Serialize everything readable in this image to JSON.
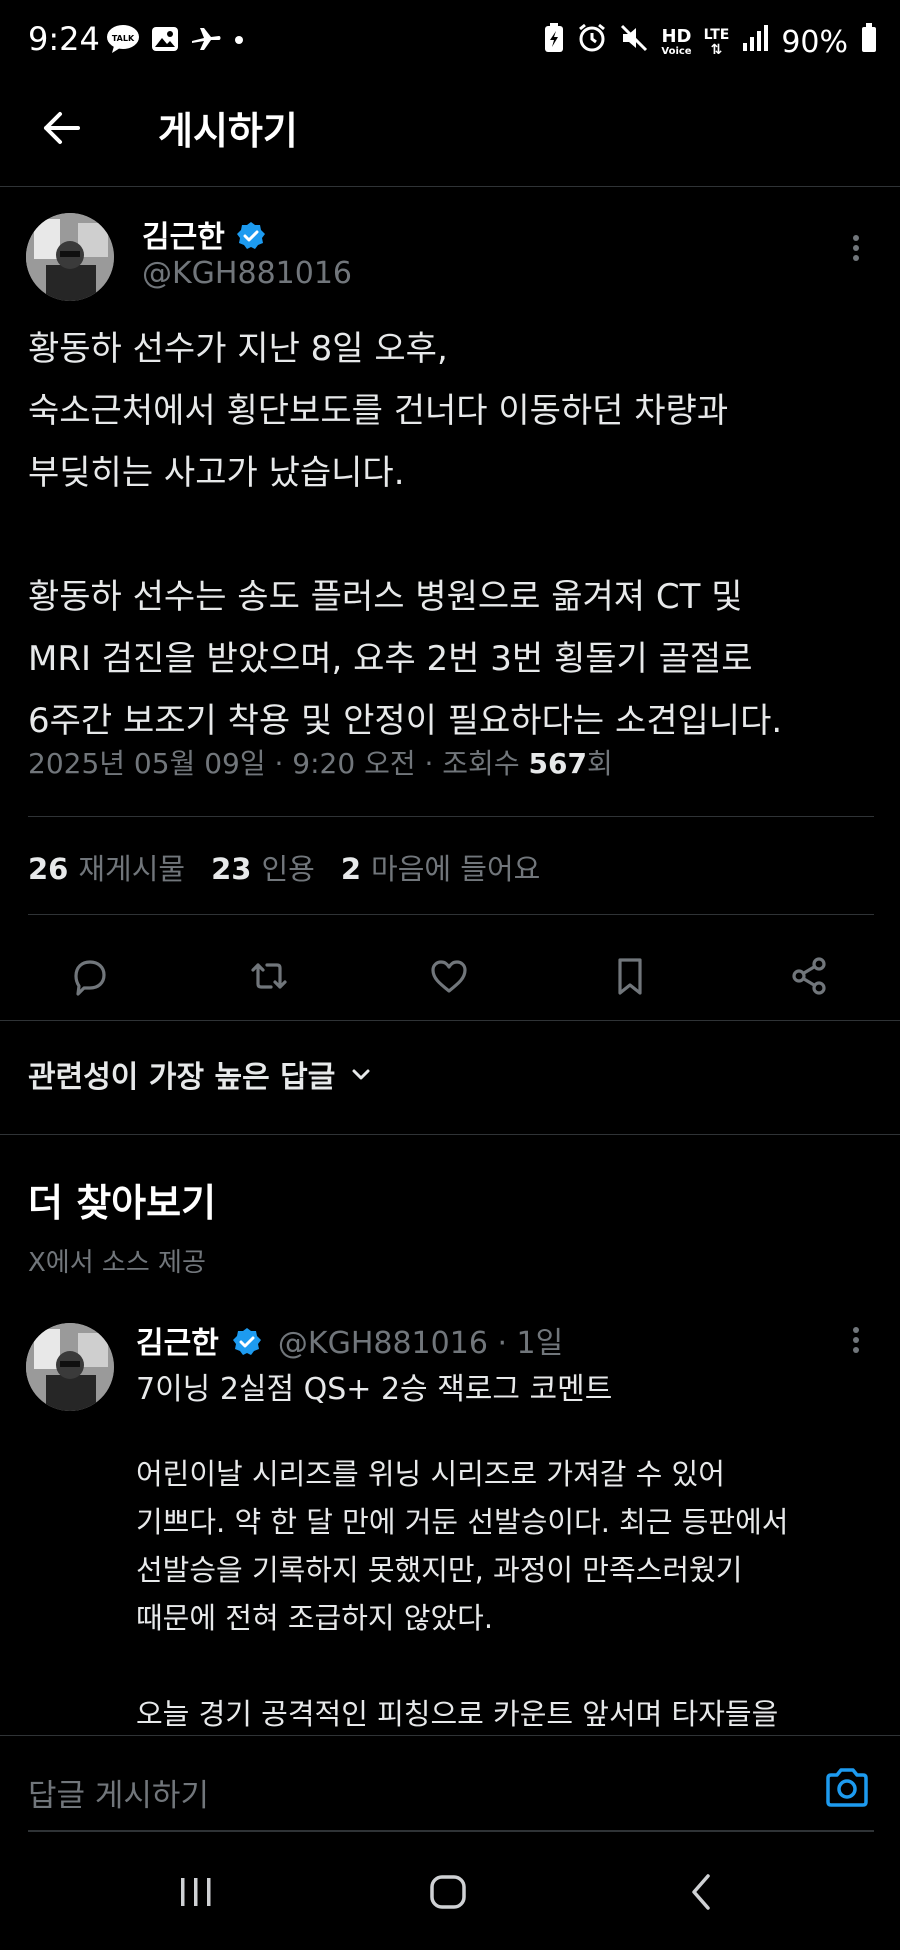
{
  "status_bar": {
    "time": "9:24",
    "left_icons": [
      "talk-icon",
      "gallery-icon",
      "airplane-icon",
      "dot-icon"
    ],
    "right_icons": [
      "battery-saver-icon",
      "alarm-icon",
      "mute-icon",
      "hd-voice-icon",
      "lte-icon",
      "signal-icon"
    ],
    "hd_label": "HD",
    "voice_label": "Voice",
    "lte_label": "LTE",
    "battery": "90%"
  },
  "header": {
    "title": "게시하기"
  },
  "post": {
    "author_name": "김근한",
    "handle": "@KGH881016",
    "text": "황동하 선수가 지난 8일 오후,\n숙소근처에서 횡단보도를 건너다 이동하던 차량과\n부딪히는 사고가 났습니다.\n\n황동하 선수는 송도 플러스 병원으로 옮겨져 CT 및\nMRI 검진을 받았으며, 요추 2번 3번 횡돌기 골절로\n6주간 보조기 착용 및 안정이 필요하다는 소견입니다.",
    "meta_prefix": "2025년 05월 09일 · 9:20 오전 · 조회수 ",
    "views": "567",
    "meta_suffix": "회",
    "stats": [
      {
        "count": "26",
        "label": "재게시물"
      },
      {
        "count": "23",
        "label": "인용"
      },
      {
        "count": "2",
        "label": "마음에 들어요"
      }
    ]
  },
  "actions": [
    "reply-icon",
    "repost-icon",
    "like-icon",
    "bookmark-icon",
    "share-icon"
  ],
  "replies_sort": {
    "label": "관련성이 가장 높은 답글"
  },
  "discover": {
    "title": "더 찾아보기",
    "subtitle": "X에서 소스 제공",
    "post": {
      "author_name": "김근한",
      "handle_time": "@KGH881016 · 1일",
      "first_line": "7이닝 2실점 QS+ 2승 잭로그 코멘트",
      "text": "어린이날 시리즈를 위닝 시리즈로 가져갈 수 있어\n기쁘다. 약 한 달 만에 거둔 선발승이다. 최근 등판에서\n선발승을 기록하지 못했지만, 과정이 만족스러웠기\n때문에 전혀 조급하지 않았다.\n\n오늘 경기 공격적인 피칭으로 카운트 앞서며 타자들을"
    }
  },
  "reply_bar": {
    "placeholder": "답글 게시하기"
  },
  "colors": {
    "accent": "#1d9bf0",
    "secondary_text": "#71767b",
    "divider": "#2f3336"
  }
}
